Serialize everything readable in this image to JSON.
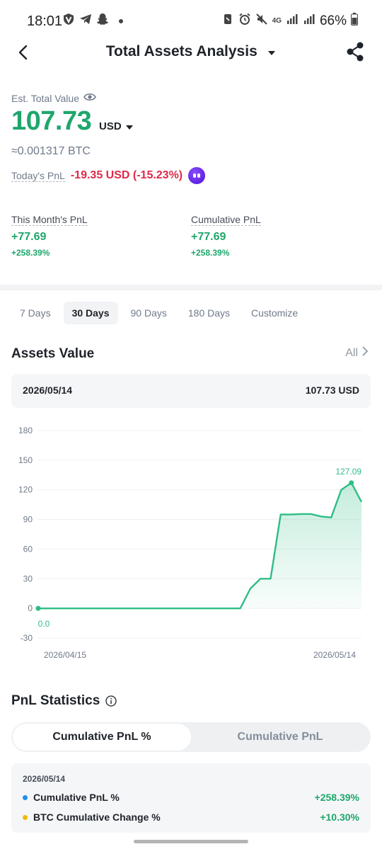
{
  "status_bar": {
    "time": "18:01",
    "network": "4G",
    "battery": "66%"
  },
  "header": {
    "title": "Total Assets Analysis"
  },
  "summary": {
    "est_label": "Est. Total Value",
    "value": "107.73",
    "currency": "USD",
    "btc_approx": "≈0.001317 BTC",
    "today_pnl_label": "Today's PnL",
    "today_pnl_value": "-19.35 USD (-15.23%)"
  },
  "pnl_cards": {
    "month_label": "This Month's PnL",
    "month_value": "+77.69",
    "month_pct": "+258.39%",
    "cumulative_label": "Cumulative PnL",
    "cumulative_value": "+77.69",
    "cumulative_pct": "+258.39%"
  },
  "range_tabs": [
    "7 Days",
    "30 Days",
    "90 Days",
    "180 Days",
    "Customize"
  ],
  "active_range": "30 Days",
  "assets_value": {
    "title": "Assets Value",
    "all_link": "All",
    "date": "2026/05/14",
    "value": "107.73 USD"
  },
  "chart_data": {
    "type": "area",
    "color": "#2ebd85",
    "yticks": [
      180,
      150,
      120,
      90,
      60,
      30,
      0,
      -30
    ],
    "ylim": [
      -30,
      180
    ],
    "x_start_label": "2026/04/15",
    "x_end_label": "2026/05/14",
    "start_annotation": "0.0",
    "peak_annotation": "127.09",
    "points": [
      {
        "x": 0,
        "y": 0
      },
      {
        "x": 1,
        "y": 0
      },
      {
        "x": 2,
        "y": 0
      },
      {
        "x": 3,
        "y": 0
      },
      {
        "x": 4,
        "y": 0
      },
      {
        "x": 5,
        "y": 0
      },
      {
        "x": 6,
        "y": 0
      },
      {
        "x": 7,
        "y": 0
      },
      {
        "x": 8,
        "y": 0
      },
      {
        "x": 9,
        "y": 0
      },
      {
        "x": 10,
        "y": 0
      },
      {
        "x": 11,
        "y": 0
      },
      {
        "x": 12,
        "y": 0
      },
      {
        "x": 13,
        "y": 0
      },
      {
        "x": 14,
        "y": 0
      },
      {
        "x": 15,
        "y": 0
      },
      {
        "x": 16,
        "y": 0
      },
      {
        "x": 17,
        "y": 0
      },
      {
        "x": 18,
        "y": 0
      },
      {
        "x": 19,
        "y": 0
      },
      {
        "x": 20,
        "y": 0
      },
      {
        "x": 21,
        "y": 20
      },
      {
        "x": 22,
        "y": 30
      },
      {
        "x": 23,
        "y": 30
      },
      {
        "x": 24,
        "y": 95
      },
      {
        "x": 25,
        "y": 95
      },
      {
        "x": 26,
        "y": 95.5
      },
      {
        "x": 27,
        "y": 95.5
      },
      {
        "x": 28,
        "y": 93
      },
      {
        "x": 29,
        "y": 92
      },
      {
        "x": 30,
        "y": 120
      },
      {
        "x": 31,
        "y": 127.09
      },
      {
        "x": 32,
        "y": 107.73
      }
    ]
  },
  "pnl_statistics": {
    "title": "PnL Statistics",
    "tab_active": "Cumulative PnL %",
    "tab_inactive": "Cumulative PnL",
    "date": "2026/05/14",
    "rows": [
      {
        "name": "Cumulative PnL %",
        "value": "+258.39%",
        "color": "#1e8fef"
      },
      {
        "name": "BTC Cumulative Change %",
        "value": "+10.30%",
        "color": "#f0b90b"
      }
    ]
  }
}
